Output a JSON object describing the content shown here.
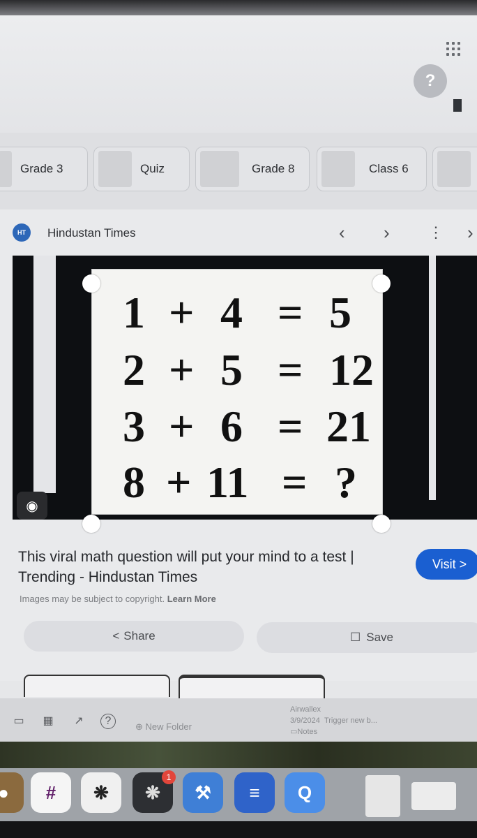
{
  "help_label": "?",
  "chips": [
    "Grade 3",
    "Quiz",
    "Grade 8",
    "Class 6"
  ],
  "source": {
    "logo_text": "HT",
    "name": "Hindustan Times"
  },
  "puzzle": {
    "rows": [
      [
        "1",
        "+",
        "4",
        "=",
        "5"
      ],
      [
        "2",
        "+",
        "5",
        "=",
        "12"
      ],
      [
        "3",
        "+",
        "6",
        "=",
        "21"
      ],
      [
        "8",
        "+",
        "11",
        "=",
        "?"
      ]
    ]
  },
  "result": {
    "title_line1": "This viral math question will put your mind to a test |",
    "title_line2": "Trending - Hindustan Times",
    "visit_label": "Visit >",
    "copyright_text": "Images may be subject to copyright.",
    "learn_more": "Learn More",
    "share_label": "Share",
    "save_label": "Save"
  },
  "bottom_bar": {
    "new_folder": "New Folder",
    "file_name": "Airwallex",
    "file_date": "3/9/2024",
    "file_trigger": "Trigger new b...",
    "file_notes": "Notes"
  },
  "dock": {
    "badge_count": "1"
  },
  "colors": {
    "accent": "#1a5fd1",
    "source_logo": "#2d67b8"
  }
}
